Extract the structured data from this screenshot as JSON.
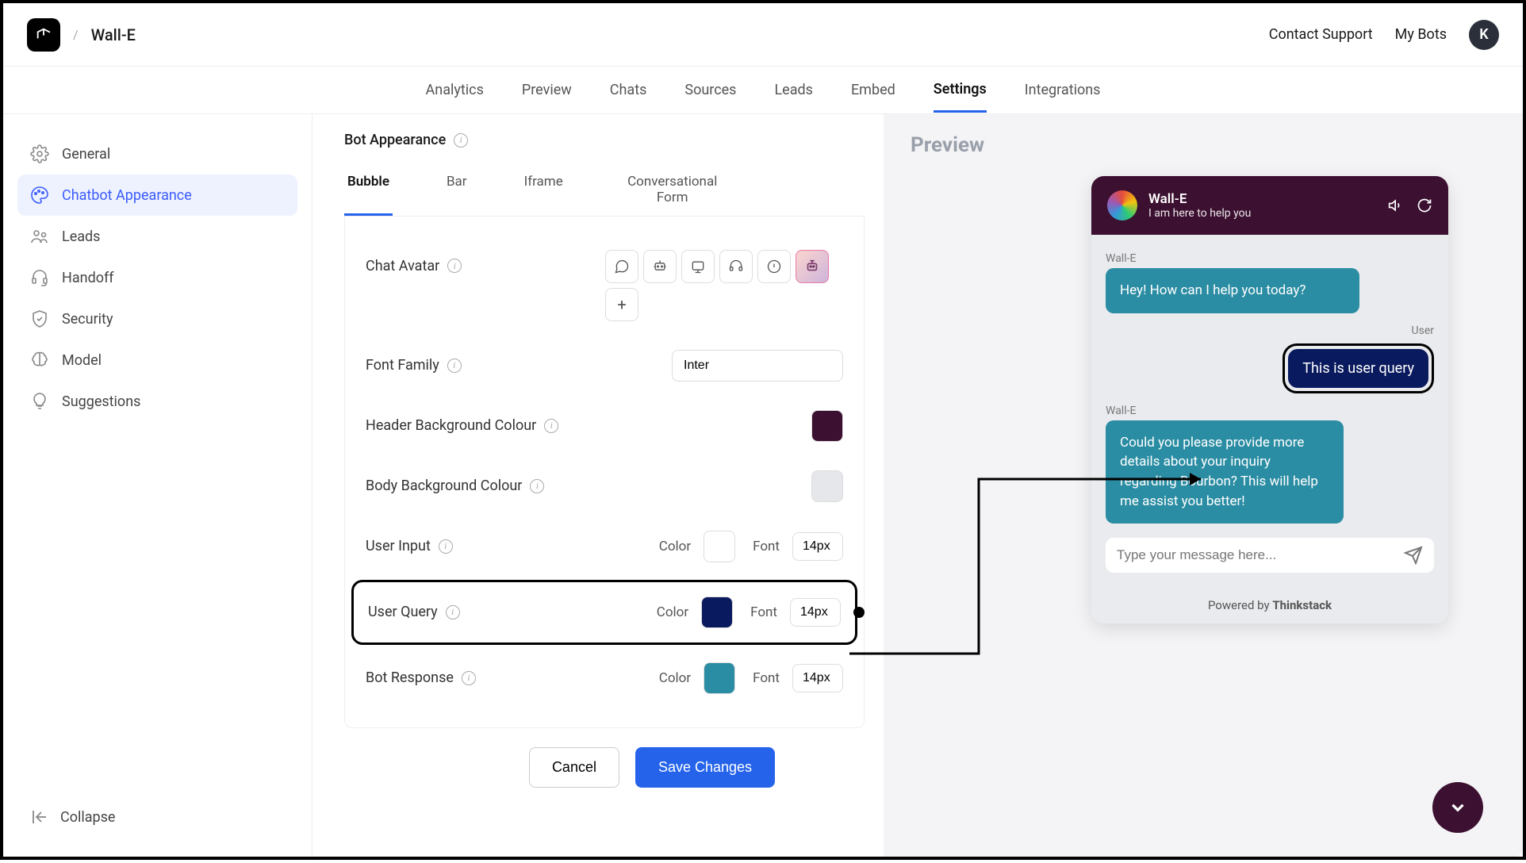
{
  "topbar": {
    "bot_name": "Wall-E",
    "contact_support": "Contact Support",
    "my_bots": "My Bots",
    "user_initial": "K"
  },
  "navtabs": [
    "Analytics",
    "Preview",
    "Chats",
    "Sources",
    "Leads",
    "Embed",
    "Settings",
    "Integrations"
  ],
  "navtabs_active": "Settings",
  "sidebar": {
    "items": [
      {
        "label": "General"
      },
      {
        "label": "Chatbot Appearance"
      },
      {
        "label": "Leads"
      },
      {
        "label": "Handoff"
      },
      {
        "label": "Security"
      },
      {
        "label": "Model"
      },
      {
        "label": "Suggestions"
      }
    ],
    "active_index": 1,
    "collapse": "Collapse"
  },
  "main": {
    "section_title": "Bot Appearance",
    "subtabs": [
      "Bubble",
      "Bar",
      "Iframe",
      "Conversational Form"
    ],
    "subtab_active": "Bubble",
    "chat_avatar_label": "Chat Avatar",
    "font_family_label": "Font Family",
    "font_family_value": "Inter",
    "header_bg_label": "Header Background Colour",
    "header_bg_color": "#3c1030",
    "body_bg_label": "Body Background Colour",
    "body_bg_color": "#e5e7eb",
    "user_input_label": "User Input",
    "user_input_color": "#ffffff",
    "user_input_font": "14px",
    "user_query_label": "User Query",
    "user_query_color": "#0a1a5e",
    "user_query_font": "14px",
    "bot_response_label": "Bot Response",
    "bot_response_color": "#2b8da3",
    "bot_response_font": "14px",
    "color_word": "Color",
    "font_word": "Font"
  },
  "actions": {
    "cancel": "Cancel",
    "save": "Save Changes"
  },
  "preview": {
    "title": "Preview",
    "bot_name": "Wall-E",
    "bot_status": "I am here to help you",
    "author_bot": "Wall-E",
    "author_user": "User",
    "msg1": "Hey! How can I help you today?",
    "user_msg": "This is user query",
    "msg2": "Could you please provide more details about your inquiry regarding Bourbon? This will help me assist you better!",
    "input_placeholder": "Type your message here...",
    "powered_by_prefix": "Powered by ",
    "powered_by_brand": "Thinkstack"
  }
}
